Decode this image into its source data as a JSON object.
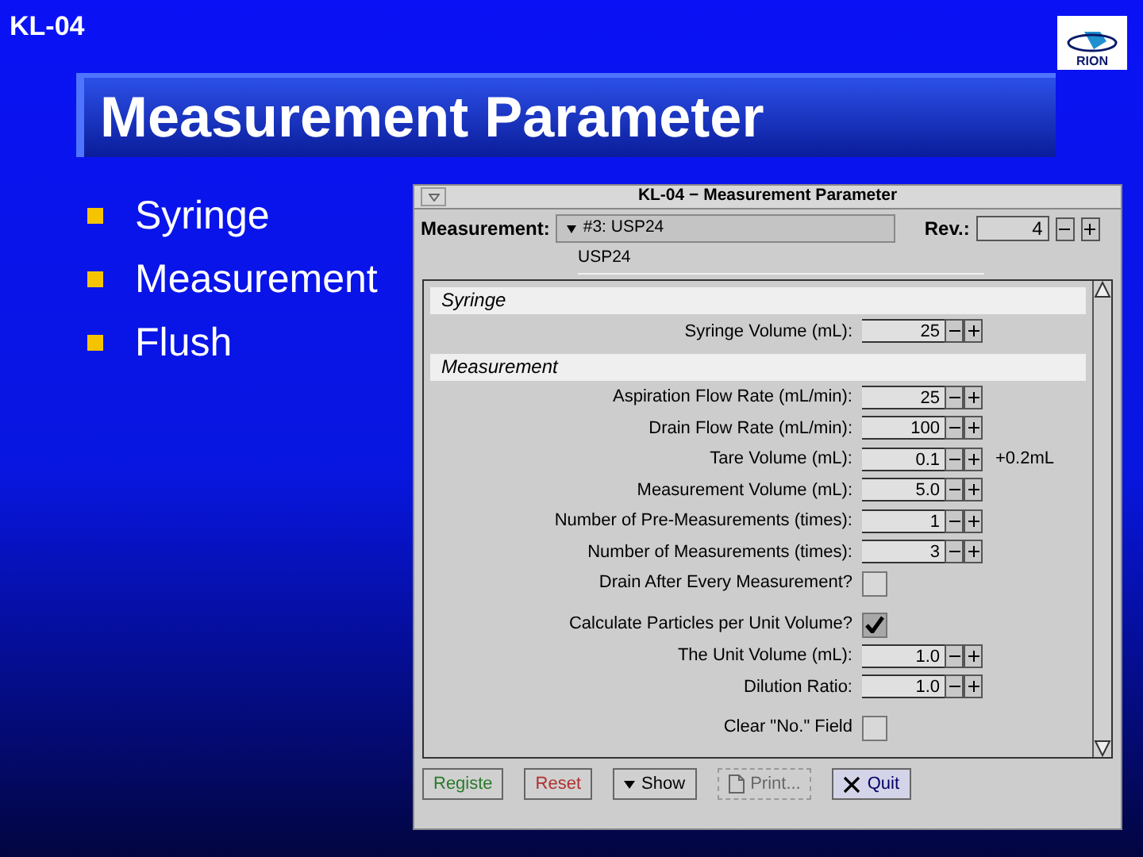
{
  "slide": {
    "header": "KL-04",
    "title": "Measurement Parameter",
    "bullets": [
      "Syringe",
      "Measurement",
      "Flush"
    ]
  },
  "logo": {
    "text": "RION"
  },
  "window": {
    "title": "KL-04 − Measurement Parameter",
    "measurement": {
      "label": "Measurement:",
      "value": "#3: USP24",
      "name": "USP24"
    },
    "rev": {
      "label": "Rev.:",
      "value": "4"
    },
    "sections": [
      {
        "title": "Syringe",
        "rows": [
          {
            "kind": "spinner",
            "label": "Syringe Volume (mL):",
            "value": "25"
          }
        ]
      },
      {
        "title": "Measurement",
        "rows": [
          {
            "kind": "spinner",
            "label": "Aspiration Flow Rate (mL/min):",
            "value": "25"
          },
          {
            "kind": "spinner",
            "label": "Drain Flow Rate (mL/min):",
            "value": "100"
          },
          {
            "kind": "spinner",
            "label": "Tare Volume (mL):",
            "value": "0.1",
            "note": "+0.2mL"
          },
          {
            "kind": "spinner",
            "label": "Measurement Volume (mL):",
            "value": "5.0"
          },
          {
            "kind": "spinner",
            "label": "Number of Pre-Measurements (times):",
            "value": "1"
          },
          {
            "kind": "spinner",
            "label": "Number of Measurements (times):",
            "value": "3"
          },
          {
            "kind": "checkbox",
            "label": "Drain After Every Measurement?",
            "checked": false
          },
          {
            "kind": "gap"
          },
          {
            "kind": "checkbox",
            "label": "Calculate Particles per Unit Volume?",
            "checked": true
          },
          {
            "kind": "spinner",
            "label": "The Unit Volume (mL):",
            "value": "1.0"
          },
          {
            "kind": "spinner",
            "label": "Dilution Ratio:",
            "value": "1.0"
          },
          {
            "kind": "gap"
          },
          {
            "kind": "checkbox",
            "label": "Clear \"No.\" Field",
            "checked": false
          }
        ]
      }
    ],
    "buttons": [
      {
        "kind": "register",
        "label": "Registe",
        "disabled": false
      },
      {
        "kind": "reset",
        "label": "Reset",
        "disabled": false
      },
      {
        "kind": "show",
        "label": "Show",
        "disabled": false
      },
      {
        "kind": "print",
        "label": "Print...",
        "disabled": true
      },
      {
        "kind": "quit",
        "label": "Quit",
        "disabled": false
      }
    ]
  }
}
